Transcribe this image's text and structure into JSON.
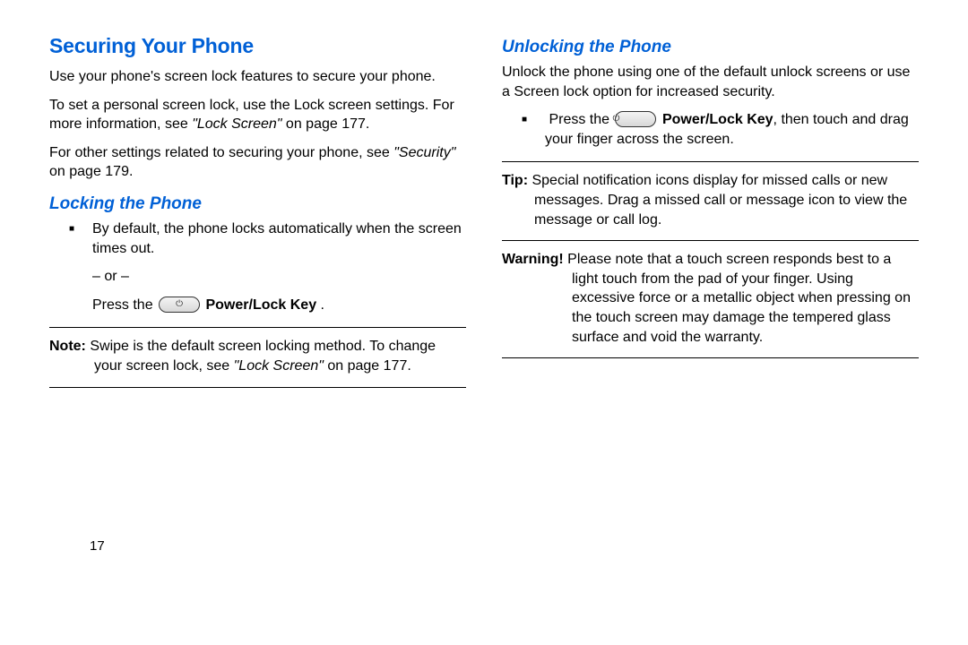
{
  "pageNumber": "17",
  "left": {
    "h1": "Securing Your Phone",
    "p1": "Use your phone's screen lock features to secure your phone.",
    "p2a": "To set a personal screen lock, use the Lock screen settings. For more information, see ",
    "p2ref": "\"Lock Screen\"",
    "p2b": " on page 177.",
    "p3a": "For other settings related to securing your phone, see ",
    "p3ref": "\"Security\"",
    "p3b": " on page 179.",
    "h2": "Locking the Phone",
    "b1": "By default, the phone locks automatically when the screen times out.",
    "or": "– or –",
    "b2a": "Press the ",
    "b2key": "Power/Lock Key",
    "b2b": " .",
    "noteLabel": "Note:",
    "noteA": " Swipe is the default screen locking method. To change your screen lock, see ",
    "noteRef": "\"Lock Screen\"",
    "noteB": " on page 177."
  },
  "right": {
    "h2": "Unlocking the Phone",
    "p1": "Unlock the phone using one of the default unlock screens or use a Screen lock option for increased security.",
    "b1a": "Press the ",
    "b1key": "Power/Lock Key",
    "b1b": ", then touch and drag your finger across the screen.",
    "tipLabel": "Tip:",
    "tipText": " Special notification icons display for missed calls or new messages. Drag a missed call or message icon to view the message or call log.",
    "warnLabel": "Warning!",
    "warnText": " Please note that a touch screen responds best to a light touch from the pad of your finger. Using excessive force or a metallic object when pressing on the touch screen may damage the tempered glass surface and void the warranty."
  }
}
